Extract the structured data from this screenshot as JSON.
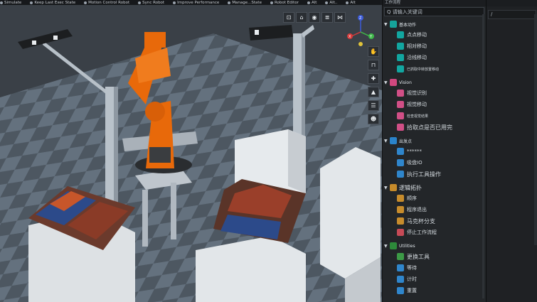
{
  "topbar": {
    "items": [
      "Simulate",
      "Keep Last Exec State",
      "Motion Control Robot",
      "Sync Robot",
      "Improve Performance",
      "Manage...State",
      "Robot Editor",
      "Alt",
      "Alt..",
      "Alt"
    ]
  },
  "panel": {
    "title": "工作流程",
    "search_placeholder": "Q 请输入关键词",
    "groups": [
      {
        "label": "基本动作",
        "big": false,
        "color": "#16a39a",
        "items": [
          {
            "label": "点点移动",
            "size": "",
            "color": "#12a6a0"
          },
          {
            "label": "相对移动",
            "size": "",
            "color": "#12a6a0"
          },
          {
            "label": "沿线移动",
            "size": "",
            "color": "#12a6a0"
          },
          {
            "label": "已抓取中转放置移动",
            "size": "sm",
            "color": "#12a6a0"
          }
        ]
      },
      {
        "label": "Vision",
        "big": false,
        "color": "#d2487f",
        "items": [
          {
            "label": "视觉识别",
            "size": "",
            "color": "#d14f86"
          },
          {
            "label": "视觉移动",
            "size": "",
            "color": "#d14f86"
          },
          {
            "label": "检查视觉结果",
            "size": "sm",
            "color": "#d14f86"
          },
          {
            "label": "拾取点是否已用完",
            "size": "md",
            "color": "#d14f86"
          }
        ]
      },
      {
        "label": "出发点",
        "big": false,
        "color": "#2a83c9",
        "items": [
          {
            "label": "******",
            "size": "",
            "color": "#2f86cc"
          },
          {
            "label": "吸盘IO",
            "size": "",
            "color": "#2f86cc"
          },
          {
            "label": "执行工具操作",
            "size": "md",
            "color": "#2f86cc"
          }
        ]
      },
      {
        "label": "逻辑拓扑",
        "big": true,
        "color": "#c58a2a",
        "items": [
          {
            "label": "顺序",
            "size": "",
            "color": "#c78c2c"
          },
          {
            "label": "程序退出",
            "size": "",
            "color": "#c78c2c"
          },
          {
            "label": "马克杯分支",
            "size": "md",
            "color": "#c78c2c"
          },
          {
            "label": "停止工作流程",
            "size": "",
            "color": "#c64a56"
          }
        ]
      },
      {
        "label": "Utilities",
        "big": false,
        "color": "#2d8a3a",
        "items": [
          {
            "label": "更换工具",
            "size": "md",
            "color": "#3c9a46"
          },
          {
            "label": "等待",
            "size": "",
            "color": "#2f86cc"
          },
          {
            "label": "计时",
            "size": "",
            "color": "#2f86cc"
          },
          {
            "label": "重置",
            "size": "",
            "color": "#2f86cc"
          }
        ]
      }
    ]
  },
  "farright": {
    "field_value": "/"
  },
  "viewport": {
    "toolbar_icons": [
      "view-cube-icon",
      "camera-icon",
      "eye-icon",
      "list-icon",
      "grid-icon"
    ],
    "side_tools": [
      "hand-icon",
      "frame-icon",
      "cross-move-icon",
      "scene-icon",
      "layers-icon",
      "robot-head-icon"
    ],
    "axis_gizmo": {
      "labels": [
        "Z",
        "X",
        "Y"
      ]
    }
  },
  "colors": {
    "robot": "#e8690a",
    "floor_dark": "#56606a",
    "floor_light": "#6d7986",
    "panel": "#232629"
  }
}
